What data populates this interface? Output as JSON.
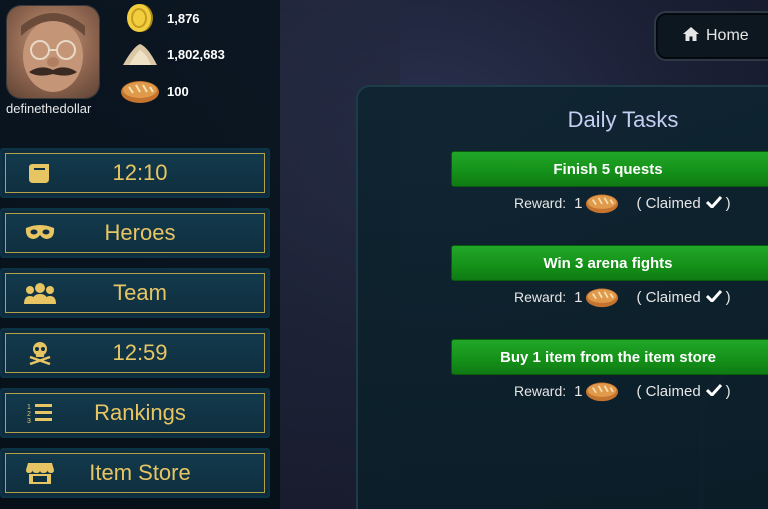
{
  "player": {
    "username": "definethedollar",
    "resources": [
      {
        "icon": "gold-coin-icon",
        "value": "1,876"
      },
      {
        "icon": "dust-pile-icon",
        "value": "1,802,683"
      },
      {
        "icon": "bread-icon",
        "value": "100"
      }
    ]
  },
  "nav": {
    "items": [
      {
        "icon": "scroll-icon",
        "label": "12:10"
      },
      {
        "icon": "mask-icon",
        "label": "Heroes"
      },
      {
        "icon": "team-icon",
        "label": "Team"
      },
      {
        "icon": "skull-crossbones-icon",
        "label": "12:59"
      },
      {
        "icon": "rankings-list-icon",
        "label": "Rankings"
      },
      {
        "icon": "store-icon",
        "label": "Item Store"
      }
    ]
  },
  "home": {
    "icon": "home-icon",
    "label": "Home"
  },
  "daily_tasks": {
    "title": "Daily Tasks",
    "reward_label": "Reward:",
    "tasks": [
      {
        "name": "Finish 5 quests",
        "reward_qty": "1",
        "reward_icon": "bread-icon",
        "status": "( Claimed",
        "status_close": ")"
      },
      {
        "name": "Win 3 arena fights",
        "reward_qty": "1",
        "reward_icon": "bread-icon",
        "status": "( Claimed",
        "status_close": ")"
      },
      {
        "name": "Buy 1 item from the item store",
        "reward_qty": "1",
        "reward_icon": "bread-icon",
        "status": "( Claimed",
        "status_close": ")"
      }
    ]
  },
  "colors": {
    "nav_text": "#e7c563",
    "nav_border": "#b4a046",
    "task_green": "#149018",
    "title_color": "#c8cdf4"
  }
}
